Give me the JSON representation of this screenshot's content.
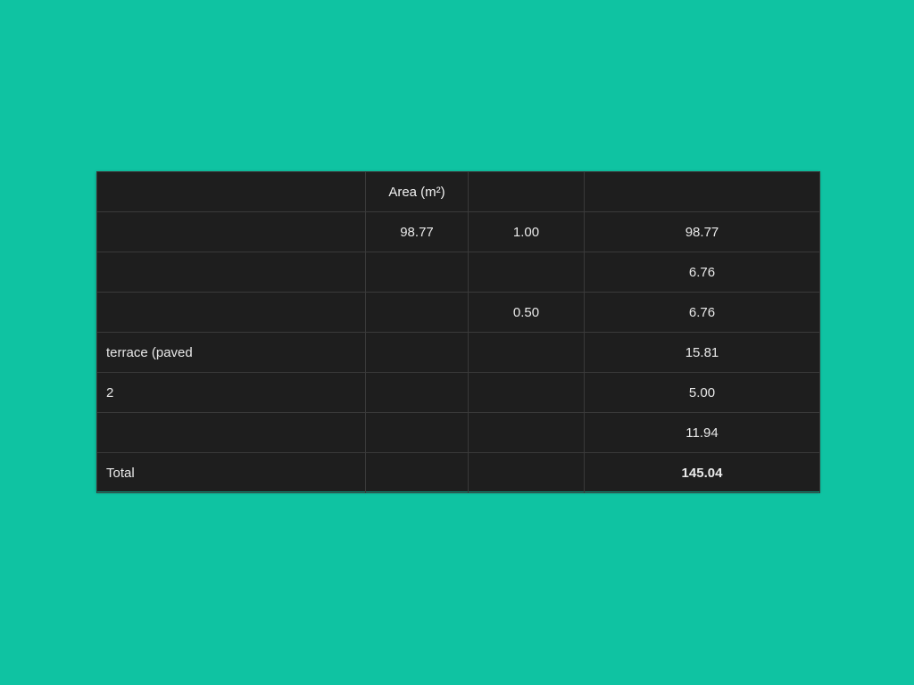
{
  "table": {
    "headers": [
      "",
      "Area (m²)",
      "",
      ""
    ],
    "rows": [
      {
        "label": "",
        "area": "98.77",
        "factor": "1.00",
        "weighted": "98.77"
      },
      {
        "label": "",
        "area": "",
        "factor": "",
        "weighted": "6.76"
      },
      {
        "label": "",
        "area": "",
        "factor": "0.50",
        "weighted": "6.76"
      },
      {
        "label": "terrace (paved",
        "area": "",
        "factor": "",
        "weighted": "15.81"
      },
      {
        "label": "2",
        "area": "",
        "factor": "",
        "weighted": "5.00"
      },
      {
        "label": "",
        "area": "",
        "factor": "",
        "weighted": "11.94"
      }
    ],
    "total": {
      "label": "Total",
      "area": "",
      "factor": "",
      "weighted": "145.04"
    }
  },
  "colors": {
    "background": "#0fc3a2",
    "table_background": "#1e1e1e",
    "grid_line": "#3a3a3a",
    "text": "#e9e9e9"
  }
}
